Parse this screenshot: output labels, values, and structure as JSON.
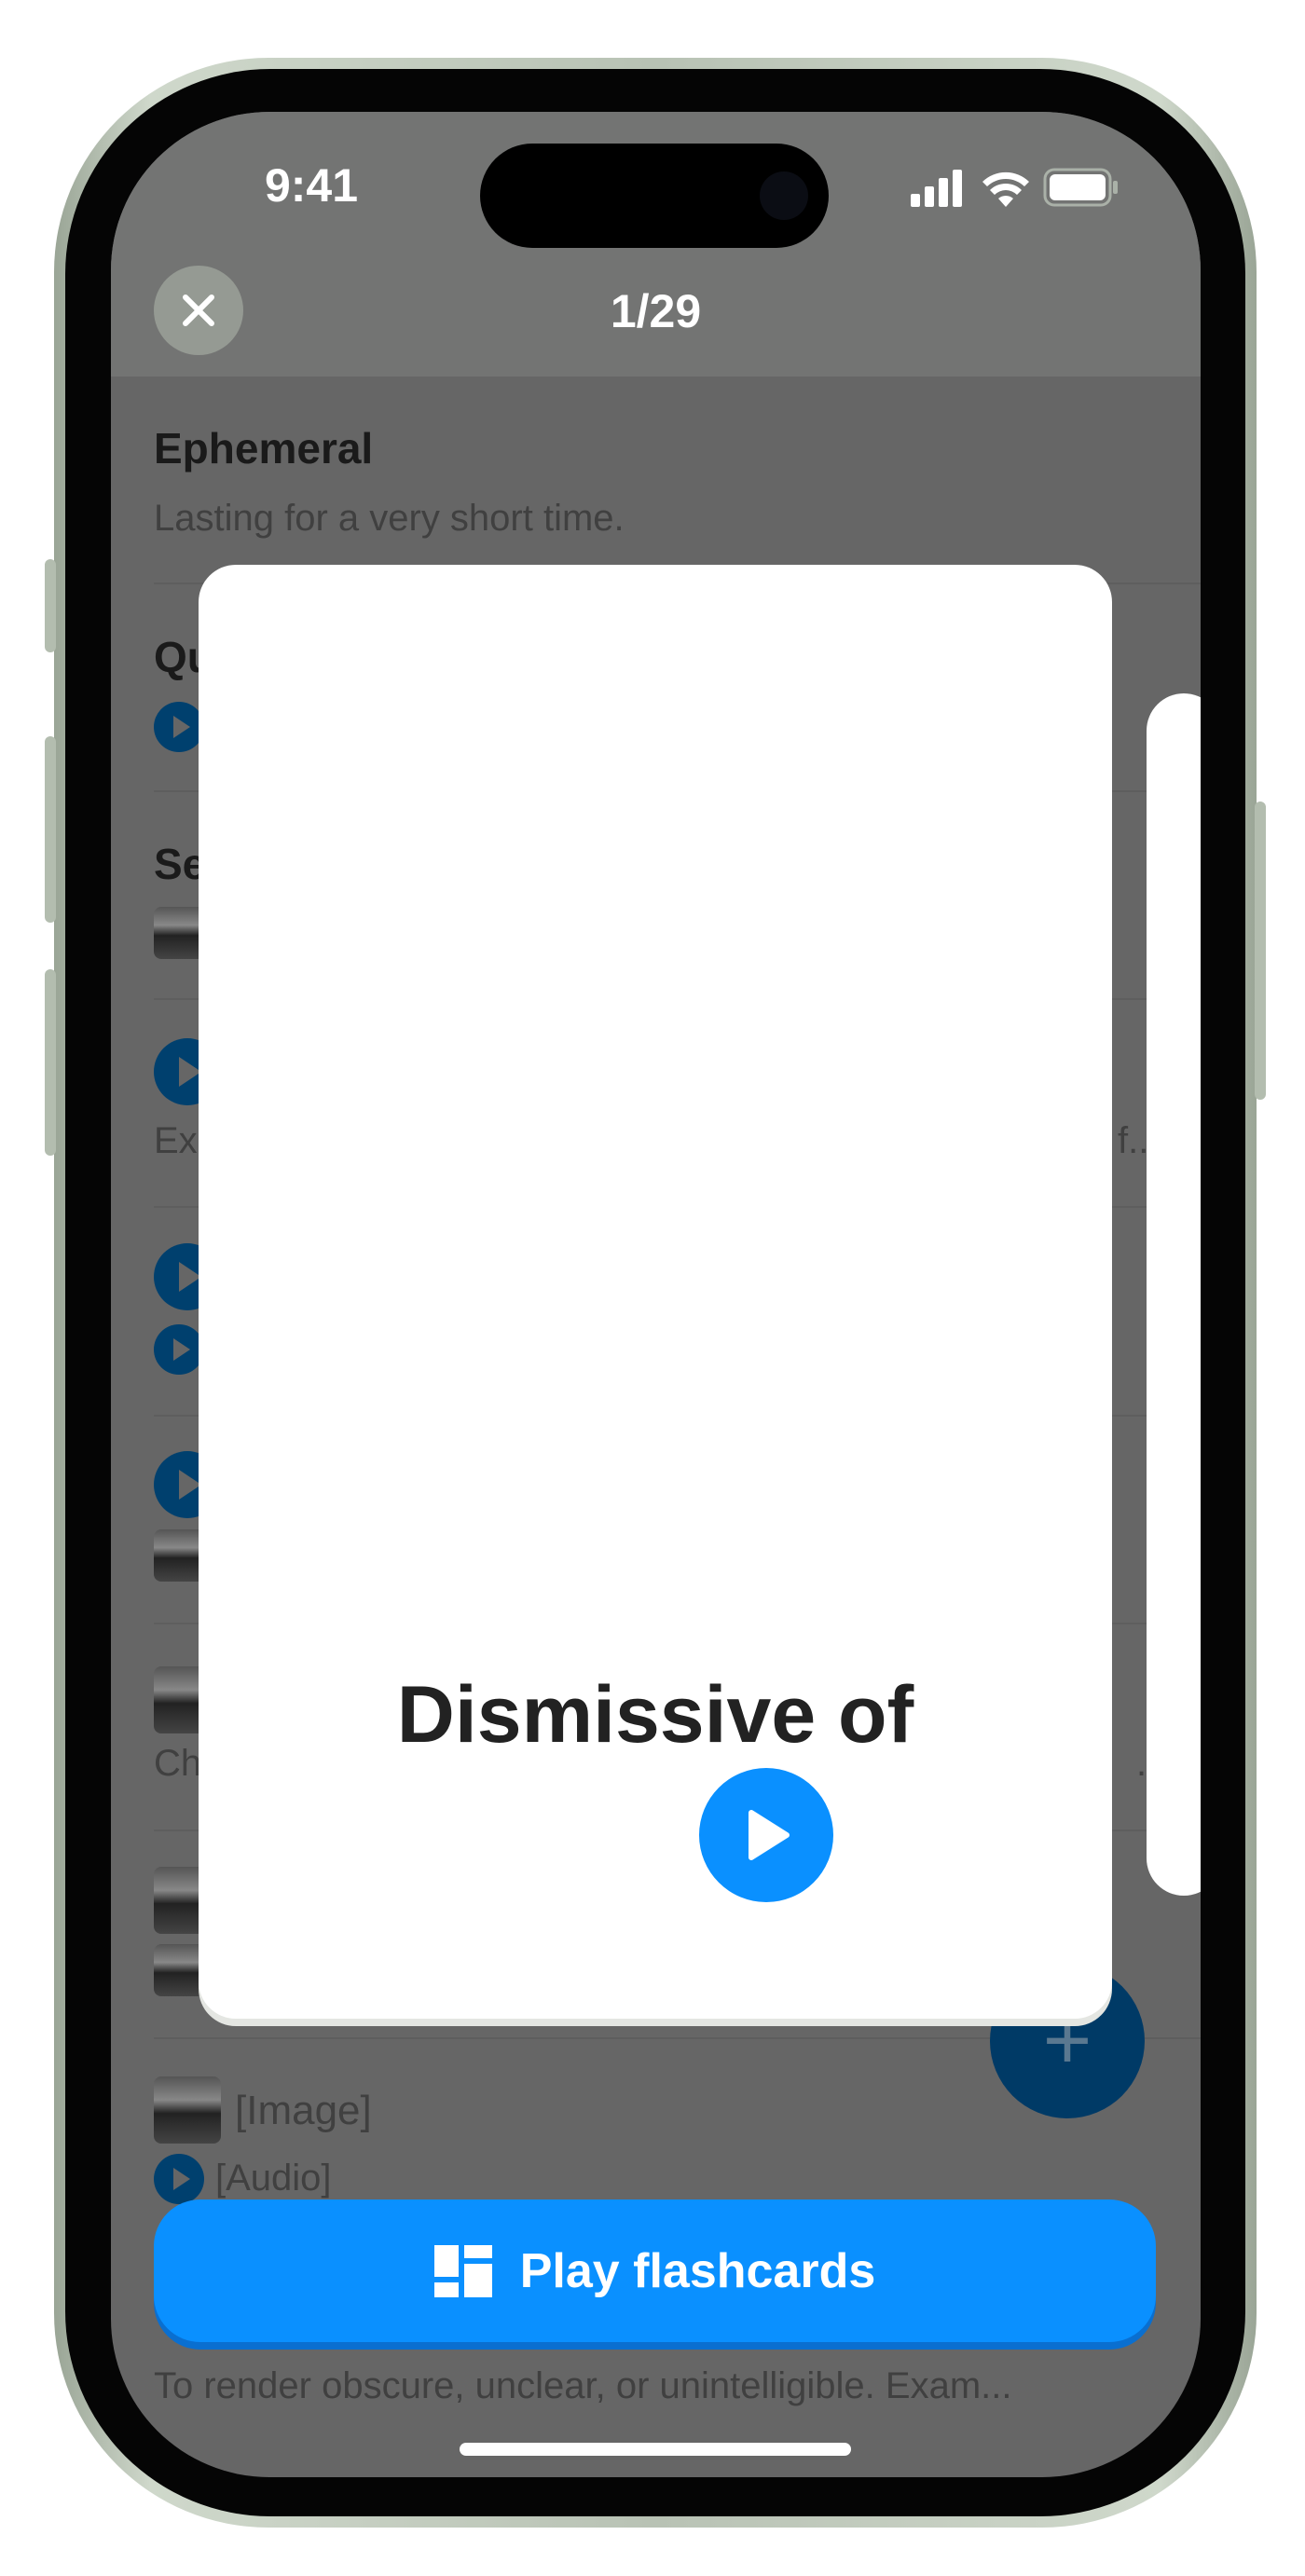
{
  "status_bar": {
    "time": "9:41",
    "icons": [
      "cellular-signal-icon",
      "wifi-icon",
      "battery-icon"
    ]
  },
  "header": {
    "counter": "1/29",
    "close_icon": "close-icon"
  },
  "list": {
    "first": {
      "title": "Ephemeral",
      "subtitle": "Lasting for a very short time."
    },
    "fragments": {
      "row2_title": "Qu",
      "row3_title": "Se",
      "row4_text": "Ex",
      "row4_right": "f...",
      "row7_text": "Ch",
      "row7_right": "..."
    },
    "row9": {
      "image_label": "[Image]",
      "audio_label": "[Audio]"
    },
    "last_subtitle": "To render obscure, unclear, or unintelligible. Exam..."
  },
  "flashcard": {
    "word": "Dismissive of",
    "play_icon": "play-icon"
  },
  "fab": {
    "icon": "plus-icon"
  },
  "play_button": {
    "label": "Play flashcards",
    "icon": "flashcards-icon"
  },
  "colors": {
    "accent": "#0a90ff",
    "fab": "#003a66",
    "overlay_bg": "#666666"
  }
}
